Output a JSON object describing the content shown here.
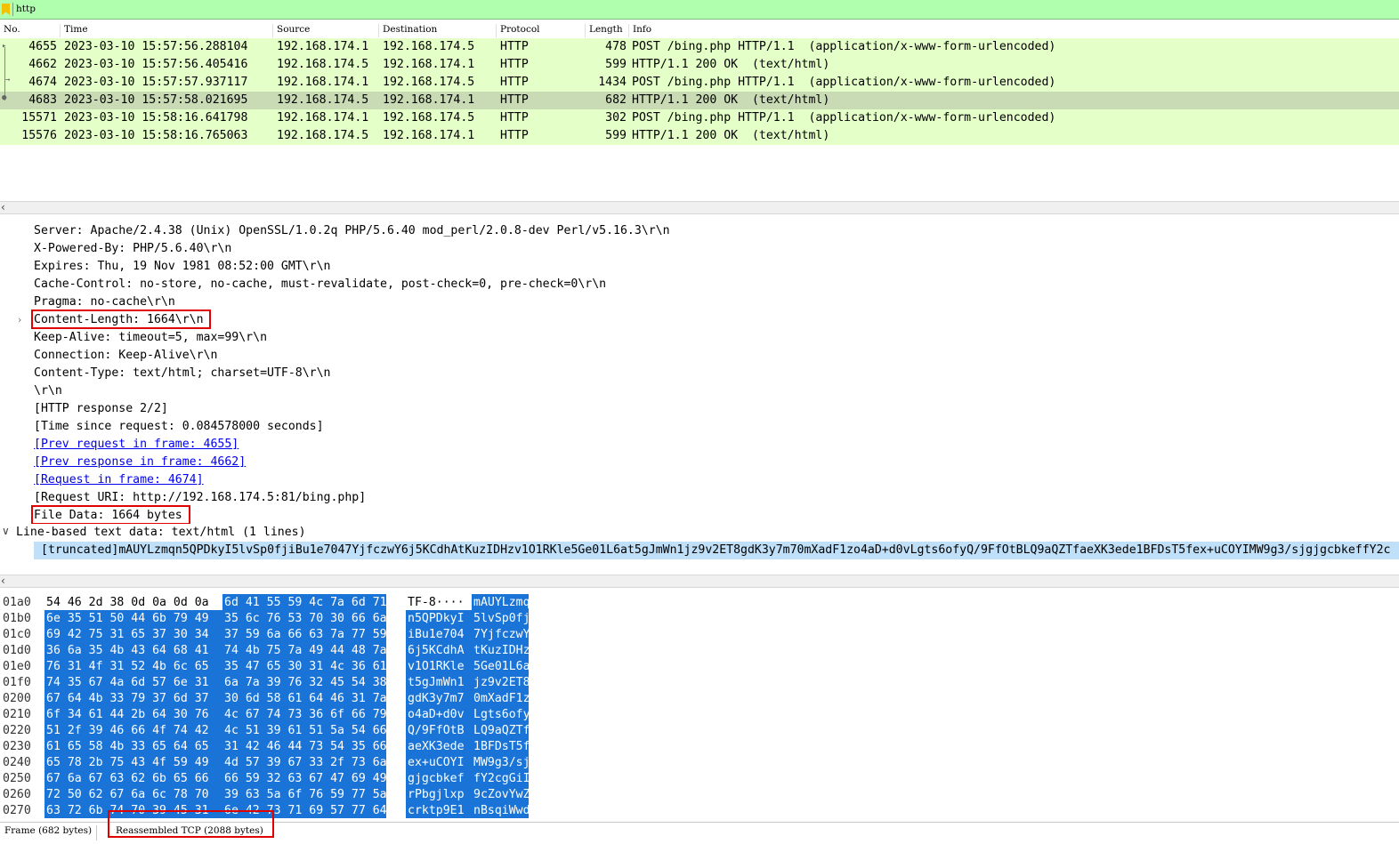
{
  "filter": {
    "text": "http"
  },
  "packet_list": {
    "columns": [
      "No.",
      "Time",
      "Source",
      "Destination",
      "Protocol",
      "Length",
      "Info"
    ],
    "rows": [
      {
        "no": "4655",
        "time": "2023-03-10 15:57:56.288104",
        "src": "192.168.174.1",
        "dst": "192.168.174.5",
        "proto": "HTTP",
        "len": "478",
        "info": "POST /bing.php HTTP/1.1  (application/x-www-form-urlencoded)"
      },
      {
        "no": "4662",
        "time": "2023-03-10 15:57:56.405416",
        "src": "192.168.174.5",
        "dst": "192.168.174.1",
        "proto": "HTTP",
        "len": "599",
        "info": "HTTP/1.1 200 OK  (text/html)"
      },
      {
        "no": "4674",
        "time": "2023-03-10 15:57:57.937117",
        "src": "192.168.174.1",
        "dst": "192.168.174.5",
        "proto": "HTTP",
        "len": "1434",
        "info": "POST /bing.php HTTP/1.1  (application/x-www-form-urlencoded)"
      },
      {
        "no": "4683",
        "time": "2023-03-10 15:57:58.021695",
        "src": "192.168.174.5",
        "dst": "192.168.174.1",
        "proto": "HTTP",
        "len": "682",
        "info": "HTTP/1.1 200 OK  (text/html)"
      },
      {
        "no": "15571",
        "time": "2023-03-10 15:58:16.641798",
        "src": "192.168.174.1",
        "dst": "192.168.174.5",
        "proto": "HTTP",
        "len": "302",
        "info": "POST /bing.php HTTP/1.1  (application/x-www-form-urlencoded)"
      },
      {
        "no": "15576",
        "time": "2023-03-10 15:58:16.765063",
        "src": "192.168.174.5",
        "dst": "192.168.174.1",
        "proto": "HTTP",
        "len": "599",
        "info": "HTTP/1.1 200 OK  (text/html)"
      }
    ]
  },
  "details": {
    "lines": [
      "Server: Apache/2.4.38 (Unix) OpenSSL/1.0.2q PHP/5.6.40 mod_perl/2.0.8-dev Perl/v5.16.3\\r\\n",
      "X-Powered-By: PHP/5.6.40\\r\\n",
      "Expires: Thu, 19 Nov 1981 08:52:00 GMT\\r\\n",
      "Cache-Control: no-store, no-cache, must-revalidate, post-check=0, pre-check=0\\r\\n",
      "Pragma: no-cache\\r\\n",
      "Content-Length: 1664\\r\\n",
      "Keep-Alive: timeout=5, max=99\\r\\n",
      "Connection: Keep-Alive\\r\\n",
      "Content-Type: text/html; charset=UTF-8\\r\\n",
      "\\r\\n",
      "[HTTP response 2/2]",
      "[Time since request: 0.084578000 seconds]",
      "[Prev request in frame: 4655]",
      "[Prev response in frame: 4662]",
      "[Request in frame: 4674]",
      "[Request URI: http://192.168.174.5:81/bing.php]",
      "File Data: 1664 bytes"
    ],
    "line_based": "Line-based text data: text/html (1 lines)",
    "truncated": "[truncated]mAUYLzmqn5QPDkyI5lvSp0fjiBu1e7047YjfczwY6j5KCdhAtKuzIDHzv1O1RKle5Ge01L6at5gJmWn1jz9v2ET8gdK3y7m70mXadF1zo4aD+d0vLgts6ofyQ/9FfOtBLQ9aQZTfaeXK3ede1BFDsT5fex+uCOYIMW9g3/sjgjgcbkeffY2c"
  },
  "hex": {
    "rows": [
      {
        "off": "01a0",
        "h1": "54 46 2d 38 0d 0a 0d 0a",
        "h2": "6d 41 55 59 4c 7a 6d 71",
        "a1": "TF-8····",
        "a2": "mAUYLzmq",
        "sel1": false
      },
      {
        "off": "01b0",
        "h1": "6e 35 51 50 44 6b 79 49",
        "h2": "35 6c 76 53 70 30 66 6a",
        "a1": "n5QPDkyI",
        "a2": "5lvSp0fj",
        "sel1": true
      },
      {
        "off": "01c0",
        "h1": "69 42 75 31 65 37 30 34",
        "h2": "37 59 6a 66 63 7a 77 59",
        "a1": "iBu1e704",
        "a2": "7YjfczwY",
        "sel1": true
      },
      {
        "off": "01d0",
        "h1": "36 6a 35 4b 43 64 68 41",
        "h2": "74 4b 75 7a 49 44 48 7a",
        "a1": "6j5KCdhA",
        "a2": "tKuzIDHz",
        "sel1": true
      },
      {
        "off": "01e0",
        "h1": "76 31 4f 31 52 4b 6c 65",
        "h2": "35 47 65 30 31 4c 36 61",
        "a1": "v1O1RKle",
        "a2": "5Ge01L6a",
        "sel1": true
      },
      {
        "off": "01f0",
        "h1": "74 35 67 4a 6d 57 6e 31",
        "h2": "6a 7a 39 76 32 45 54 38",
        "a1": "t5gJmWn1",
        "a2": "jz9v2ET8",
        "sel1": true
      },
      {
        "off": "0200",
        "h1": "67 64 4b 33 79 37 6d 37",
        "h2": "30 6d 58 61 64 46 31 7a",
        "a1": "gdK3y7m7",
        "a2": "0mXadF1z",
        "sel1": true
      },
      {
        "off": "0210",
        "h1": "6f 34 61 44 2b 64 30 76",
        "h2": "4c 67 74 73 36 6f 66 79",
        "a1": "o4aD+d0v",
        "a2": "Lgts6ofy",
        "sel1": true
      },
      {
        "off": "0220",
        "h1": "51 2f 39 46 66 4f 74 42",
        "h2": "4c 51 39 61 51 5a 54 66",
        "a1": "Q/9FfOtB",
        "a2": "LQ9aQZTf",
        "sel1": true
      },
      {
        "off": "0230",
        "h1": "61 65 58 4b 33 65 64 65",
        "h2": "31 42 46 44 73 54 35 66",
        "a1": "aeXK3ede",
        "a2": "1BFDsT5f",
        "sel1": true
      },
      {
        "off": "0240",
        "h1": "65 78 2b 75 43 4f 59 49",
        "h2": "4d 57 39 67 33 2f 73 6a",
        "a1": "ex+uCOYI",
        "a2": "MW9g3/sj",
        "sel1": true
      },
      {
        "off": "0250",
        "h1": "67 6a 67 63 62 6b 65 66",
        "h2": "66 59 32 63 67 47 69 49",
        "a1": "gjgcbkef",
        "a2": "fY2cgGiI",
        "sel1": true
      },
      {
        "off": "0260",
        "h1": "72 50 62 67 6a 6c 78 70",
        "h2": "39 63 5a 6f 76 59 77 5a",
        "a1": "rPbgjlxp",
        "a2": "9cZovYwZ",
        "sel1": true
      },
      {
        "off": "0270",
        "h1": "63 72 6b 74 70 39 45 31",
        "h2": "6e 42 73 71 69 57 77 64",
        "a1": "crktp9E1",
        "a2": "nBsqiWwd",
        "sel1": true
      }
    ]
  },
  "tabs": {
    "frame": "Frame (682 bytes)",
    "reassembled": "Reassembled TCP (2088 bytes)"
  },
  "colors": {
    "filter_bg": "#afffaf",
    "row_bg": "#e4ffc7",
    "row_selected": "#c9dbb5",
    "hex_selection": "#1a73d6",
    "highlight_box": "#e00000"
  }
}
